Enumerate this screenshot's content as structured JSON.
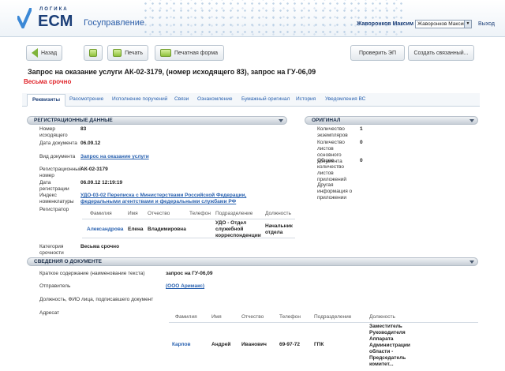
{
  "header": {
    "logo_small": "ЛОГИКА",
    "logo_big": "ECM",
    "app_name": "Госуправление",
    "user_name": "Жаворонков Максим",
    "user_select": "Жаворонков Максим",
    "exit": "Выход"
  },
  "toolbar": {
    "back": "Назад",
    "print": "Печать",
    "print_form": "Печатная форма",
    "verify_ep": "Проверить ЭП",
    "create_related": "Создать связанный..."
  },
  "document": {
    "title": "Запрос на оказание услуги АК-02-3179, (номер исходящего 83), запрос на ГУ-06,09",
    "urgency": "Весьма срочно"
  },
  "tabs": [
    "Реквизиты",
    "Рассмотрение",
    "Исполнение поручений",
    "Связи",
    "Ознакомление",
    "Бумажный оригинал",
    "История",
    "Уведомления ВС"
  ],
  "registration": {
    "section_title": "РЕГИСТРАЦИОННЫЕ ДАННЫЕ",
    "outgoing_number_label": "Номер исходящего",
    "outgoing_number": "83",
    "doc_date_label": "Дата документа",
    "doc_date": "06.09.12",
    "doc_type_label": "Вид документа",
    "doc_type": "Запрос на оказание услуги",
    "reg_number_label": "Регистрационный номер",
    "reg_number": "АК-02-3179",
    "reg_date_label": "Дата регистрации",
    "reg_date": "06.09.12 12:19:19",
    "nomenclature_label": "Индекс номенклатуры",
    "nomenclature": "УДО-03-02 Переписка с Министерствами Российской Федерации, федеральными агентствами и федеральными службами РФ",
    "registrar_label": "Регистратор",
    "registrar_columns": [
      "Фамилия",
      "Имя",
      "Отчество",
      "Телефон",
      "Подразделение",
      "Должность"
    ],
    "registrar_row": {
      "surname": "Александрова",
      "name": "Елена",
      "patronymic": "Владимировна",
      "phone": "",
      "department": "УДО - Отдел служебной корреспонденции",
      "position": "Начальник отдела"
    },
    "urgency_label": "Категория срочности",
    "urgency_value": "Весьма срочно"
  },
  "original": {
    "section_title": "ОРИГИНАЛ",
    "copies_label": "Количество экземпляров",
    "copies": "1",
    "sheets_label": "Количество листов основного документа",
    "sheets": "0",
    "attach_label": "Общее количество листов приложений",
    "attach": "0",
    "other_label": "Другая информация о приложении"
  },
  "doc_info": {
    "section_title": "СВЕДЕНИЯ О ДОКУМЕНТЕ",
    "summary_label": "Краткое содержание (наименование текста)",
    "summary": "запрос на ГУ-06,09",
    "sender_label": "Отправитель",
    "sender": "(ООО Аримакс)",
    "signer_label": "Должность, ФИО лица, подписавшего документ",
    "addressee_label": "Адресат",
    "addressee_columns": [
      "Фамилия",
      "Имя",
      "Отчество",
      "Телефон",
      "Подразделение",
      "Должность"
    ],
    "addressee_row": {
      "surname": "Карпов",
      "name": "Андрей",
      "patronymic": "Иванович",
      "phone": "69-97-72",
      "department": "ГПК",
      "position": "Заместитель Руководителя Аппарата Администрации области - Председатель комитет..."
    }
  }
}
